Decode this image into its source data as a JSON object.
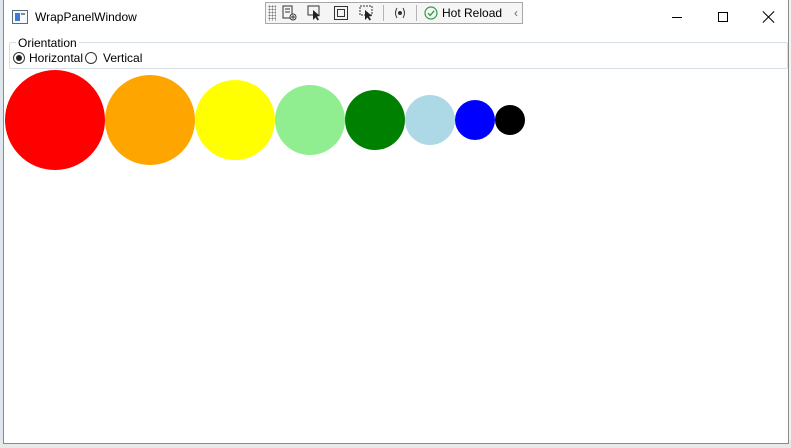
{
  "window": {
    "title": "WrapPanelWindow"
  },
  "toolbar": {
    "buttons": [
      {
        "icon": "live-visual-tree-icon"
      },
      {
        "icon": "select-element-icon"
      },
      {
        "icon": "display-layout-adorners-icon"
      },
      {
        "icon": "track-focused-element-icon"
      },
      {
        "icon": "binding-failures-icon"
      }
    ],
    "hot_reload_label": "Hot Reload",
    "collapse_icon": "chevron-left-icon"
  },
  "orientation": {
    "legend": "Orientation",
    "options": [
      {
        "label": "Horizontal",
        "selected": true
      },
      {
        "label": "Vertical",
        "selected": false
      }
    ]
  },
  "circles": [
    {
      "color": "#ff0000"
    },
    {
      "color": "#ffa500"
    },
    {
      "color": "#ffff00"
    },
    {
      "color": "#90ee90"
    },
    {
      "color": "#008000"
    },
    {
      "color": "#add8e6"
    },
    {
      "color": "#0000ff"
    },
    {
      "color": "#000000"
    }
  ]
}
